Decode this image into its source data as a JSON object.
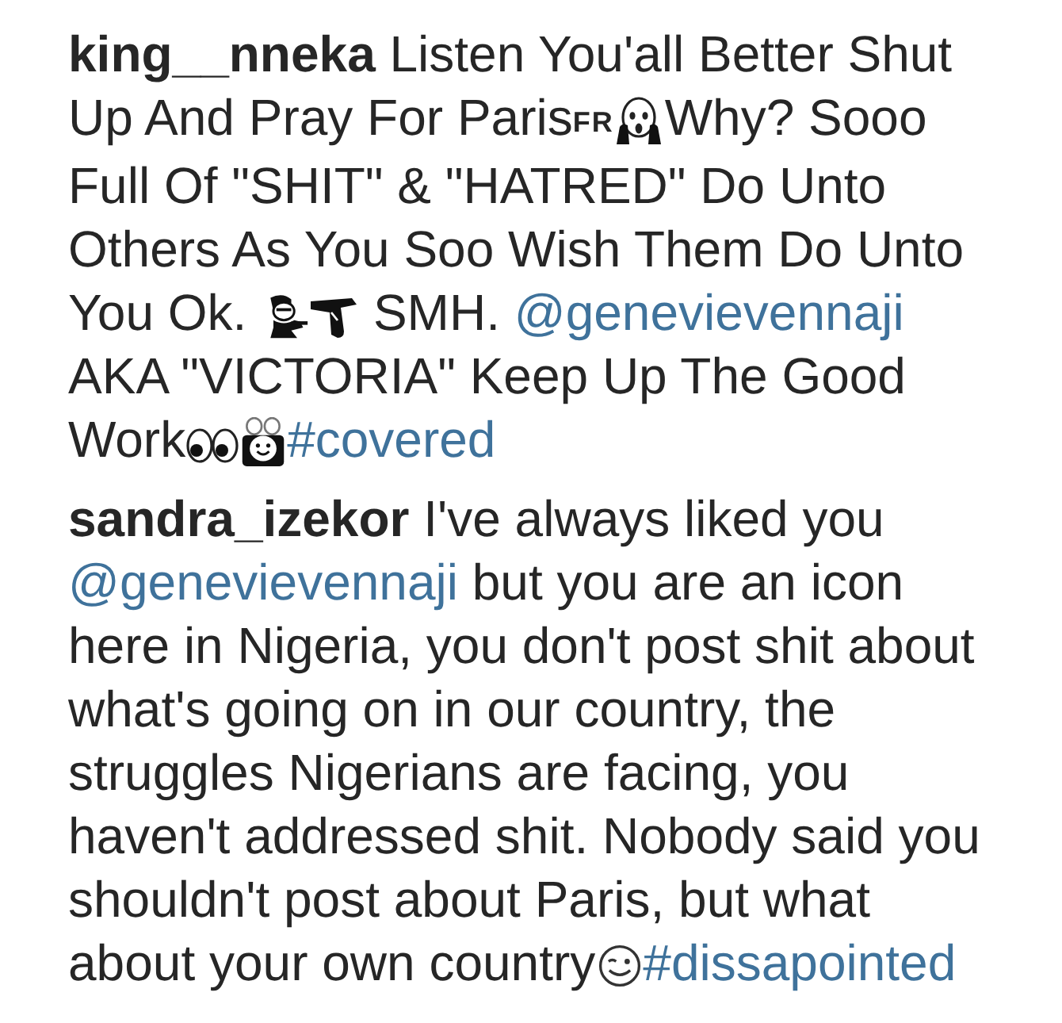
{
  "comments": [
    {
      "lines": [
        [
          {
            "kind": "username",
            "text": "king__nneka"
          },
          {
            "kind": "text",
            "text": " Listen You'all Better Shut"
          }
        ],
        [
          {
            "kind": "text",
            "text": "Up And Pray For Paris"
          },
          {
            "kind": "letters",
            "text": "FR"
          },
          {
            "kind": "scream"
          },
          {
            "kind": "text",
            "text": "Why? Sooo"
          }
        ],
        [
          {
            "kind": "text",
            "text": "Full Of \"SHIT\" & \"HATRED\" Do Unto"
          }
        ],
        [
          {
            "kind": "text",
            "text": "Others As You Soo Wish Them Do Unto"
          }
        ],
        [
          {
            "kind": "text",
            "text": "You Ok. "
          },
          {
            "kind": "person"
          },
          {
            "kind": "gun"
          },
          {
            "kind": "text",
            "text": " SMH. "
          },
          {
            "kind": "mention",
            "text": "@genevievennaji"
          }
        ],
        [
          {
            "kind": "text",
            "text": "AKA \"VICTORIA\" Keep Up The Good"
          }
        ],
        [
          {
            "kind": "text",
            "text": "Work"
          },
          {
            "kind": "eyes"
          },
          {
            "kind": "creature"
          },
          {
            "kind": "hashtag",
            "text": "#covered"
          }
        ]
      ]
    },
    {
      "lines": [
        [
          {
            "kind": "username",
            "text": "sandra_izekor"
          },
          {
            "kind": "text",
            "text": " I've always liked you"
          }
        ],
        [
          {
            "kind": "mention",
            "text": "@genevievennaji"
          },
          {
            "kind": "text",
            "text": " but you are an icon"
          }
        ],
        [
          {
            "kind": "text",
            "text": "here in Nigeria, you don't post shit about"
          }
        ],
        [
          {
            "kind": "text",
            "text": "what's going on in our country, the"
          }
        ],
        [
          {
            "kind": "text",
            "text": "struggles Nigerians are facing, you"
          }
        ],
        [
          {
            "kind": "text",
            "text": "haven't addressed shit. Nobody said you"
          }
        ],
        [
          {
            "kind": "text",
            "text": "shouldn't post about Paris, but what"
          }
        ],
        [
          {
            "kind": "text",
            "text": "about your own country"
          },
          {
            "kind": "wink"
          },
          {
            "kind": "hashtag",
            "text": "#dissapointed"
          }
        ]
      ]
    }
  ]
}
